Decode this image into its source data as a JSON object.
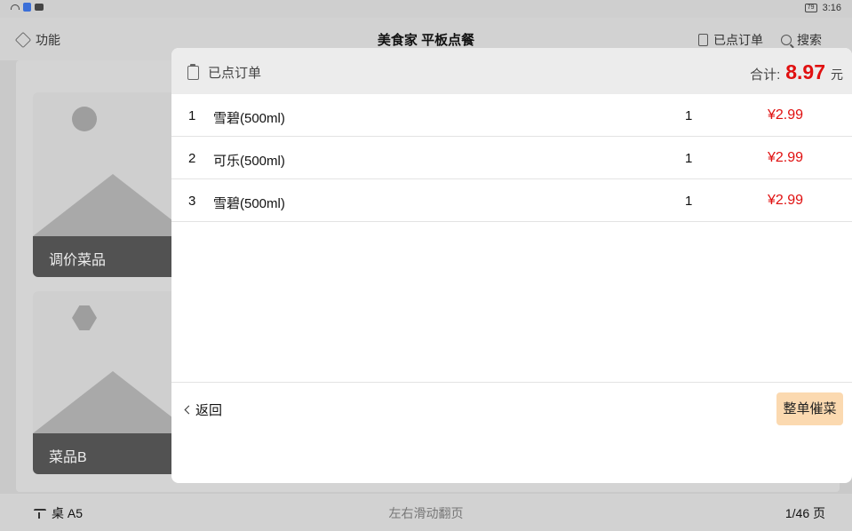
{
  "status_bar": {
    "time": "3:16",
    "battery": "79"
  },
  "top_bar": {
    "func_label": "功能",
    "title": "美食家 平板点餐",
    "ordered_label": "已点订单",
    "search_label": "搜索"
  },
  "menu": {
    "cards": [
      {
        "label": "调价菜品"
      },
      {
        "label": "菜品B"
      }
    ]
  },
  "bottom_bar": {
    "table": "桌 A5",
    "hint": "左右滑动翻页",
    "page": "1/46 页"
  },
  "modal": {
    "title": "已点订单",
    "total_label": "合计:",
    "total_value": "8.97",
    "total_unit": "元",
    "orders": [
      {
        "index": "1",
        "name": "雪碧(500ml)",
        "qty": "1",
        "price": "¥2.99"
      },
      {
        "index": "2",
        "name": "可乐(500ml)",
        "qty": "1",
        "price": "¥2.99"
      },
      {
        "index": "3",
        "name": "雪碧(500ml)",
        "qty": "1",
        "price": "¥2.99"
      }
    ],
    "back_label": "返回",
    "urge_label": "整单催菜"
  },
  "colors": {
    "accent_price": "#e01010",
    "urge_button": "#fbd9b0"
  }
}
